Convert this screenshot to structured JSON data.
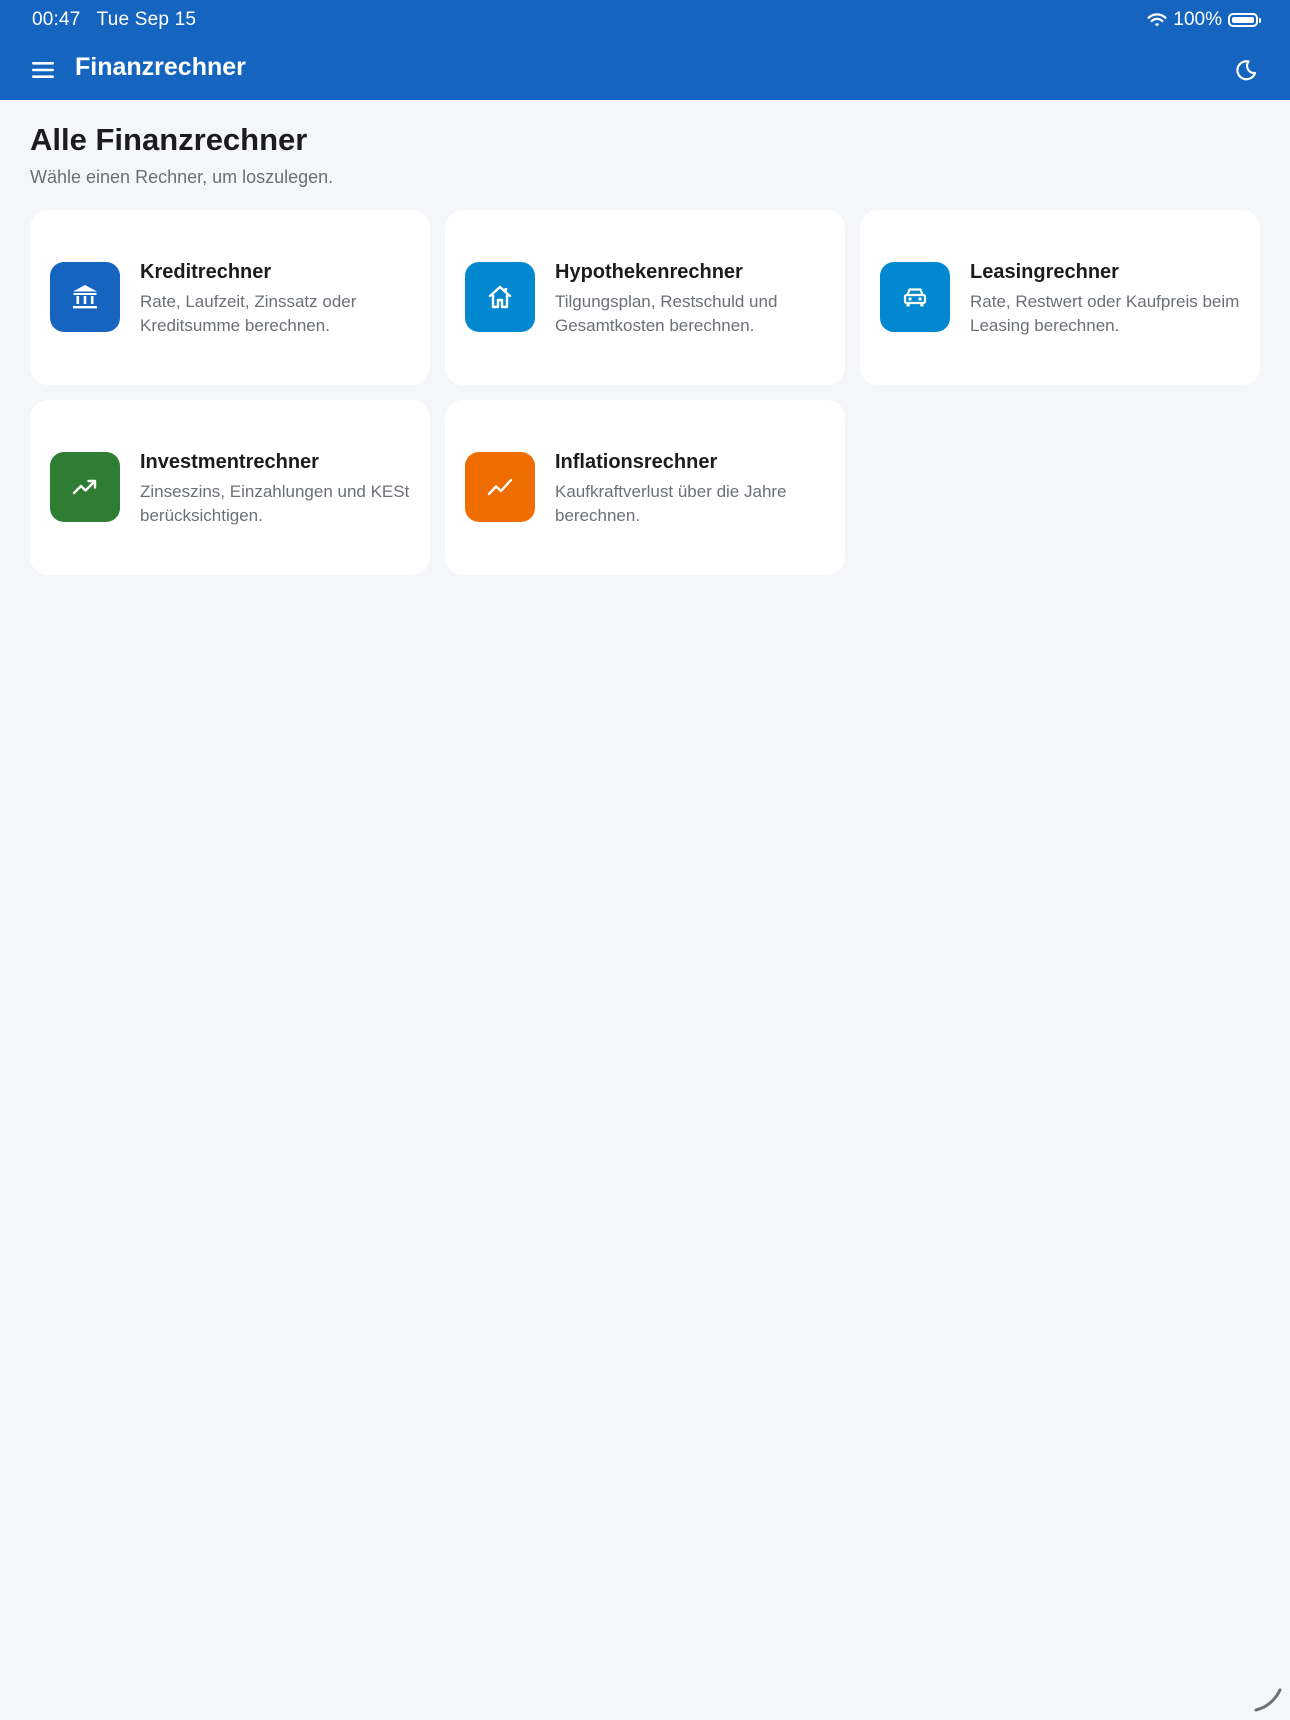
{
  "status_bar": {
    "time": "00:47",
    "date": "Tue Sep 15",
    "battery": "100%",
    "icons": [
      "wifi-icon",
      "battery-icon"
    ]
  },
  "app_bar": {
    "title": "Finanzrechner",
    "menu_icon": "menu-icon",
    "theme_icon": "moon-icon",
    "color": "#1565c0"
  },
  "page": {
    "title": "Alle Finanzrechner",
    "subtitle": "Wähle einen Rechner, um loszulegen."
  },
  "cards": [
    {
      "title": "Kreditrechner",
      "description": "Rate, Laufzeit, Zinssatz oder Kreditsumme berechnen.",
      "icon": "bank-icon",
      "color": "#1565c0"
    },
    {
      "title": "Hypothekenrechner",
      "description": "Tilgungsplan, Restschuld und Gesamtkosten berechnen.",
      "icon": "house-icon",
      "color": "#0288d1"
    },
    {
      "title": "Leasingrechner",
      "description": "Rate, Restwert oder Kaufpreis beim Leasing berechnen.",
      "icon": "car-icon",
      "color": "#0288d1"
    },
    {
      "title": "Investmentrechner",
      "description": "Zinseszins, Einzahlungen und KESt berücksichtigen.",
      "icon": "trending-up-icon",
      "color": "#2e7d32"
    },
    {
      "title": "Inflationsrechner",
      "description": "Kaufkraftverlust über die Jahre berechnen.",
      "icon": "show-chart-icon",
      "color": "#ef6c00"
    }
  ]
}
